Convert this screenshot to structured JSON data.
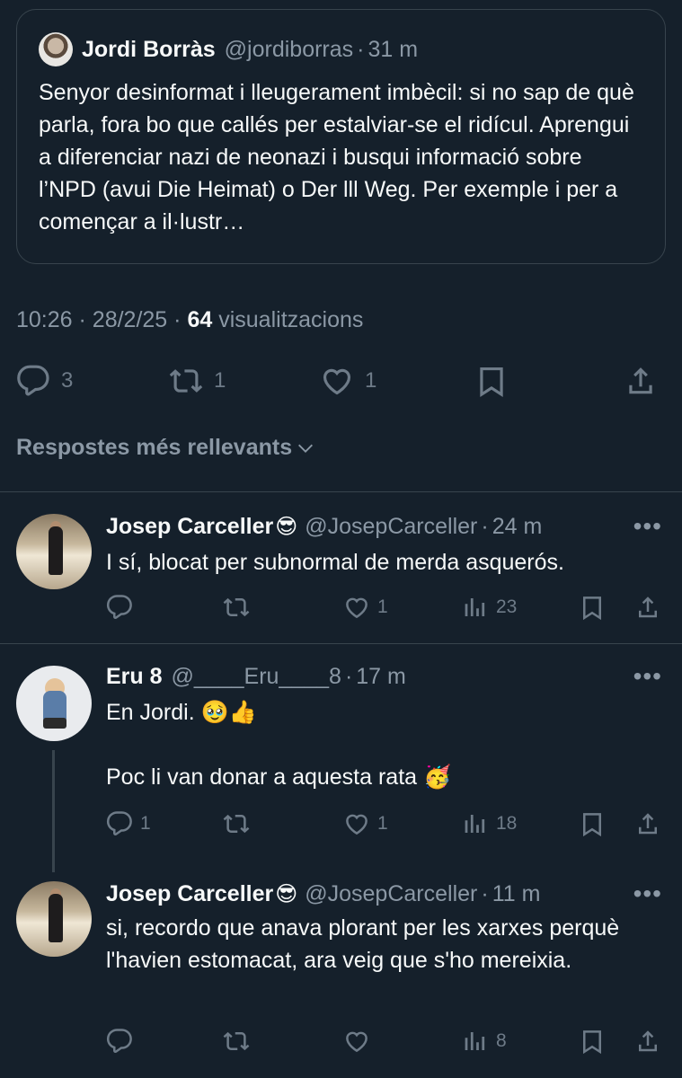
{
  "quote": {
    "name": "Jordi Borràs",
    "handle": "@jordiborras",
    "time": "31 m",
    "text": "Senyor desinformat i lleugerament imbècil: si no sap de què parla, fora bo que callés per estalviar-se el ridícul. Aprengui a diferenciar nazi de neonazi i busqui informació sobre l’NPD (avui Die Heimat) o Der lll Weg. Per exemple i per a començar a il·lustr…"
  },
  "meta": {
    "time": "10:26",
    "date": "28/2/25",
    "views": "64",
    "views_label": "visualitzacions"
  },
  "actions": {
    "replies": "3",
    "retweets": "1",
    "likes": "1"
  },
  "sort_label": "Respostes més rellevants",
  "replies": [
    {
      "name": "Josep Carceller",
      "emoji": "😎",
      "handle": "@JosepCarceller",
      "time": "24 m",
      "text": "I sí, blocat per subnormal de merda asquerós.",
      "reply_count": "",
      "retweet_count": "",
      "like_count": "1",
      "views": "23"
    },
    {
      "name": "Eru 8",
      "emoji": "",
      "handle": "@____Eru____8",
      "time": "17 m",
      "text": "En Jordi. 🥹👍\n\nPoc li van donar a aquesta rata 🥳",
      "reply_count": "1",
      "retweet_count": "",
      "like_count": "1",
      "views": "18"
    },
    {
      "name": "Josep Carceller",
      "emoji": "😎",
      "handle": "@JosepCarceller",
      "time": "11 m",
      "text": "si, recordo que anava plorant per les xarxes perquè l'havien estomacat, ara veig que s'ho mereixia.",
      "reply_count": "",
      "retweet_count": "",
      "like_count": "",
      "views": "8"
    }
  ],
  "separator": "·",
  "more_label": "•••",
  "colors": {
    "background": "#15202b",
    "text": "#f7f9f9",
    "muted": "#8b98a5",
    "border": "#38444d"
  }
}
